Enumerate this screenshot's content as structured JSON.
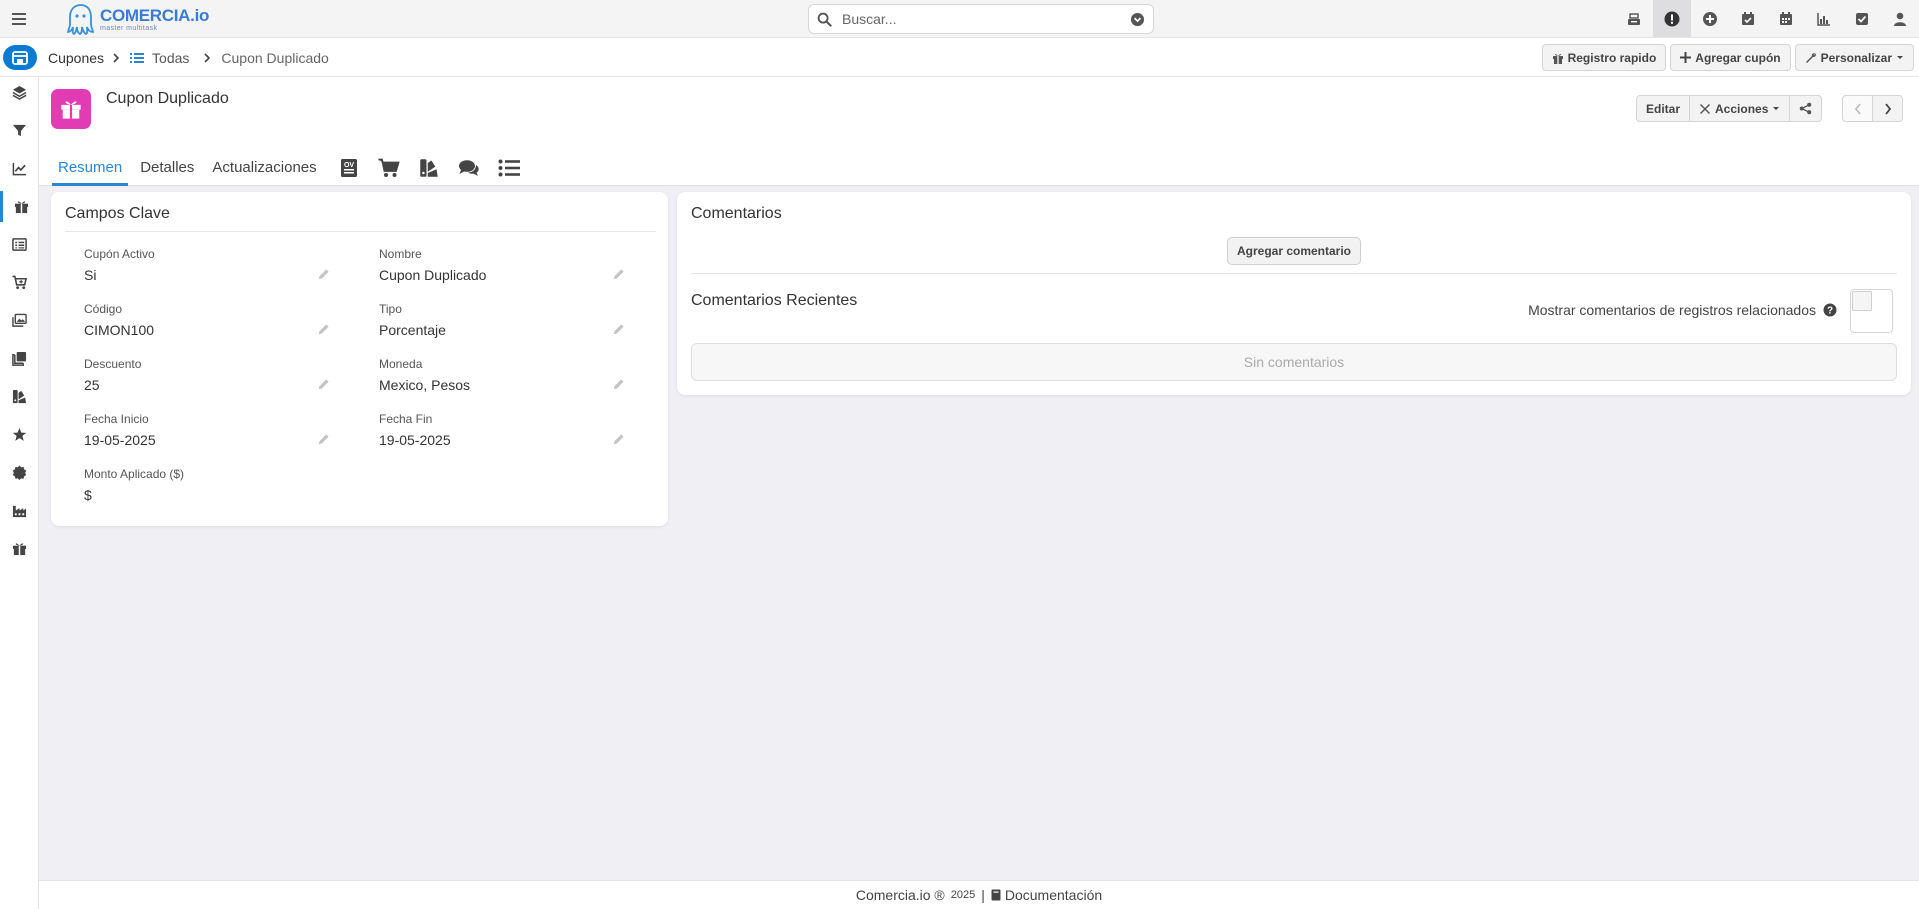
{
  "header": {
    "logo_name": "COMERCIA.io",
    "logo_tagline": "master multitask",
    "search_placeholder": "Buscar...",
    "icons": [
      "cash-register-icon",
      "alert-icon",
      "add-circle-icon",
      "calendar-check-icon",
      "calendar-icon",
      "chart-icon",
      "checkbox-icon",
      "user-icon"
    ],
    "active_icon": "alert-icon"
  },
  "breadcrumb": {
    "module": "Cupones",
    "list": "Todas",
    "record": "Cupon Duplicado"
  },
  "toolbar": {
    "quick_create": "Registro rapido",
    "add_coupon": "Agregar cupón",
    "customize": "Personalizar"
  },
  "sidebar": {
    "items": [
      "layers-icon",
      "filter-icon",
      "chart-line-icon",
      "gift-icon",
      "list-icon",
      "cart-icon",
      "images-icon",
      "copy-icon",
      "swatches-icon",
      "star-icon",
      "certificate-icon",
      "factory-icon",
      "gift-icon"
    ],
    "active_index": 3
  },
  "record": {
    "title": "Cupon Duplicado",
    "edit_label": "Editar",
    "actions_label": "Acciones",
    "tabs": [
      "Resumen",
      "Detalles",
      "Actualizaciones"
    ],
    "active_tab": "Resumen",
    "tab_icons": [
      "quote-icon",
      "cart-icon",
      "swatches-icon",
      "comments-icon",
      "list-icon"
    ]
  },
  "key_fields": {
    "title": "Campos Clave",
    "fields": [
      {
        "label": "Cupón Activo",
        "value": "Si"
      },
      {
        "label": "Nombre",
        "value": "Cupon Duplicado"
      },
      {
        "label": "Código",
        "value": "CIMON100"
      },
      {
        "label": "Tipo",
        "value": "Porcentaje"
      },
      {
        "label": "Descuento",
        "value": "25"
      },
      {
        "label": "Moneda",
        "value": "Mexico, Pesos"
      },
      {
        "label": "Fecha Inicio",
        "value": "19-05-2025"
      },
      {
        "label": "Fecha Fin",
        "value": "19-05-2025"
      },
      {
        "label": "Monto Aplicado ($)",
        "value": "$"
      }
    ]
  },
  "comments": {
    "title": "Comentarios",
    "add_label": "Agregar comentario",
    "recent_title": "Comentarios Recientes",
    "show_related_label": "Mostrar comentarios de registros relacionados",
    "empty_label": "Sin comentarios"
  },
  "footer": {
    "brand": "Comercia.io ®",
    "year": "2025",
    "separator": "|",
    "docs": "Documentación"
  },
  "colors": {
    "accent": "#2a86d1",
    "record_icon": "#e23cb5",
    "home_button": "#0b7bd1"
  }
}
